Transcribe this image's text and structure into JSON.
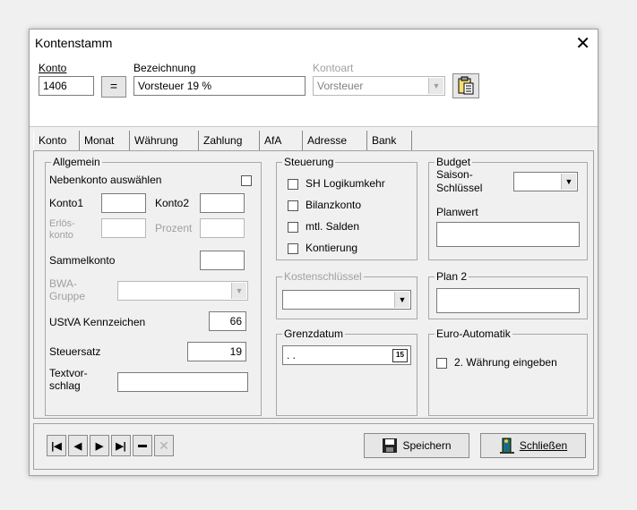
{
  "window": {
    "title": "Kontenstamm",
    "close_glyph": "✕"
  },
  "header": {
    "konto_label": "Konto",
    "konto_value": "1406",
    "equals_label": "=",
    "bezeichnung_label": "Bezeichnung",
    "bezeichnung_value": "Vorsteuer 19 %",
    "kontoart_label": "Kontoart",
    "kontoart_value": "Vorsteuer"
  },
  "tabs": [
    "Konto",
    "Monat",
    "Währung",
    "Zahlung",
    "AfA",
    "Adresse",
    "Bank"
  ],
  "allgemein": {
    "title": "Allgemein",
    "nebenkonto": "Nebenkonto auswählen",
    "konto1": "Konto1",
    "konto2": "Konto2",
    "erloes_line1": "Erlös-",
    "erloes_line2": "konto",
    "prozent": "Prozent",
    "sammelkonto": "Sammelkonto",
    "bwa_line1": "BWA-",
    "bwa_line2": "Gruppe",
    "ustva": "UStVA Kennzeichen",
    "ustva_value": "66",
    "steuersatz": "Steuersatz",
    "steuersatz_value": "19",
    "textvor_line1": "Textvor-",
    "textvor_line2": "schlag"
  },
  "steuerung": {
    "title": "Steuerung",
    "items": [
      "SH Logikumkehr",
      "Bilanzkonto",
      "mtl. Salden",
      "Kontierung"
    ]
  },
  "budget": {
    "title": "Budget",
    "saison_line1": "Saison-",
    "saison_line2": "Schlüssel",
    "planwert": "Planwert"
  },
  "kostenschluessel": {
    "title": "Kostenschlüssel"
  },
  "plan2": {
    "title": "Plan 2"
  },
  "grenzdatum": {
    "title": "Grenzdatum",
    "value": ". .",
    "calendar": "15"
  },
  "euro": {
    "title": "Euro-Automatik",
    "checkbox": "2. Währung eingeben"
  },
  "footer": {
    "save": "Speichern",
    "close": "Schließen"
  }
}
